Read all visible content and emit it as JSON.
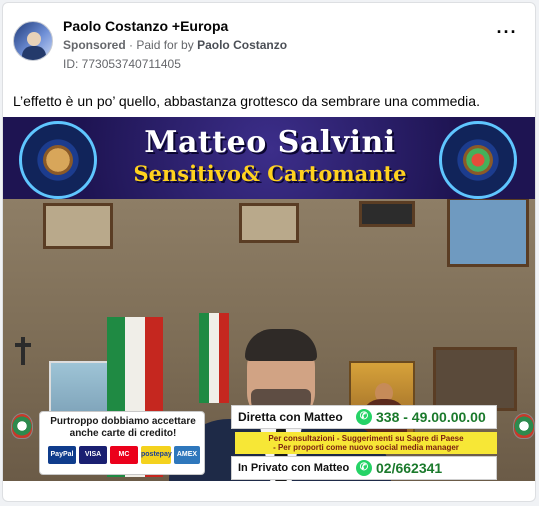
{
  "post": {
    "page_name": "Paolo Costanzo +Europa",
    "sponsored": "Sponsored",
    "separator": "·",
    "paid_for_by_label": "Paid for by",
    "paid_for_by_name": "Paolo Costanzo",
    "ad_id": "ID: 773053740711405",
    "more_icon": "ellipsis-icon",
    "caption": "L’effetto è un po’ quello, abbastanza grottesco da sembrare una commedia."
  },
  "video": {
    "banner_title": "Matteo Salvini",
    "banner_subtitle": "Sensitivo& Cartomante",
    "payments_text_line1": "Purtroppo dobbiamo accettare",
    "payments_text_line2": "anche carte di credito!",
    "payment_cards": [
      "PayPal",
      "VISA",
      "MC",
      "postepay",
      "AMEX"
    ],
    "direct_label": "Diretta con Matteo",
    "direct_number": "338 - 49.00.00.00",
    "consult_line1": "Per consultazioni - Suggerimenti su Sagre di Paese",
    "consult_line2": "- Per proporti come nuovo social media manager",
    "private_label": "In Privato con Matteo",
    "private_number": "02/662341"
  },
  "colors": {
    "banner_bg": "#1e1452",
    "banner_subtitle": "#ffd21e",
    "whatsapp": "#25d366",
    "phone_number": "#1b7a2c",
    "highlight": "#f7e736"
  }
}
